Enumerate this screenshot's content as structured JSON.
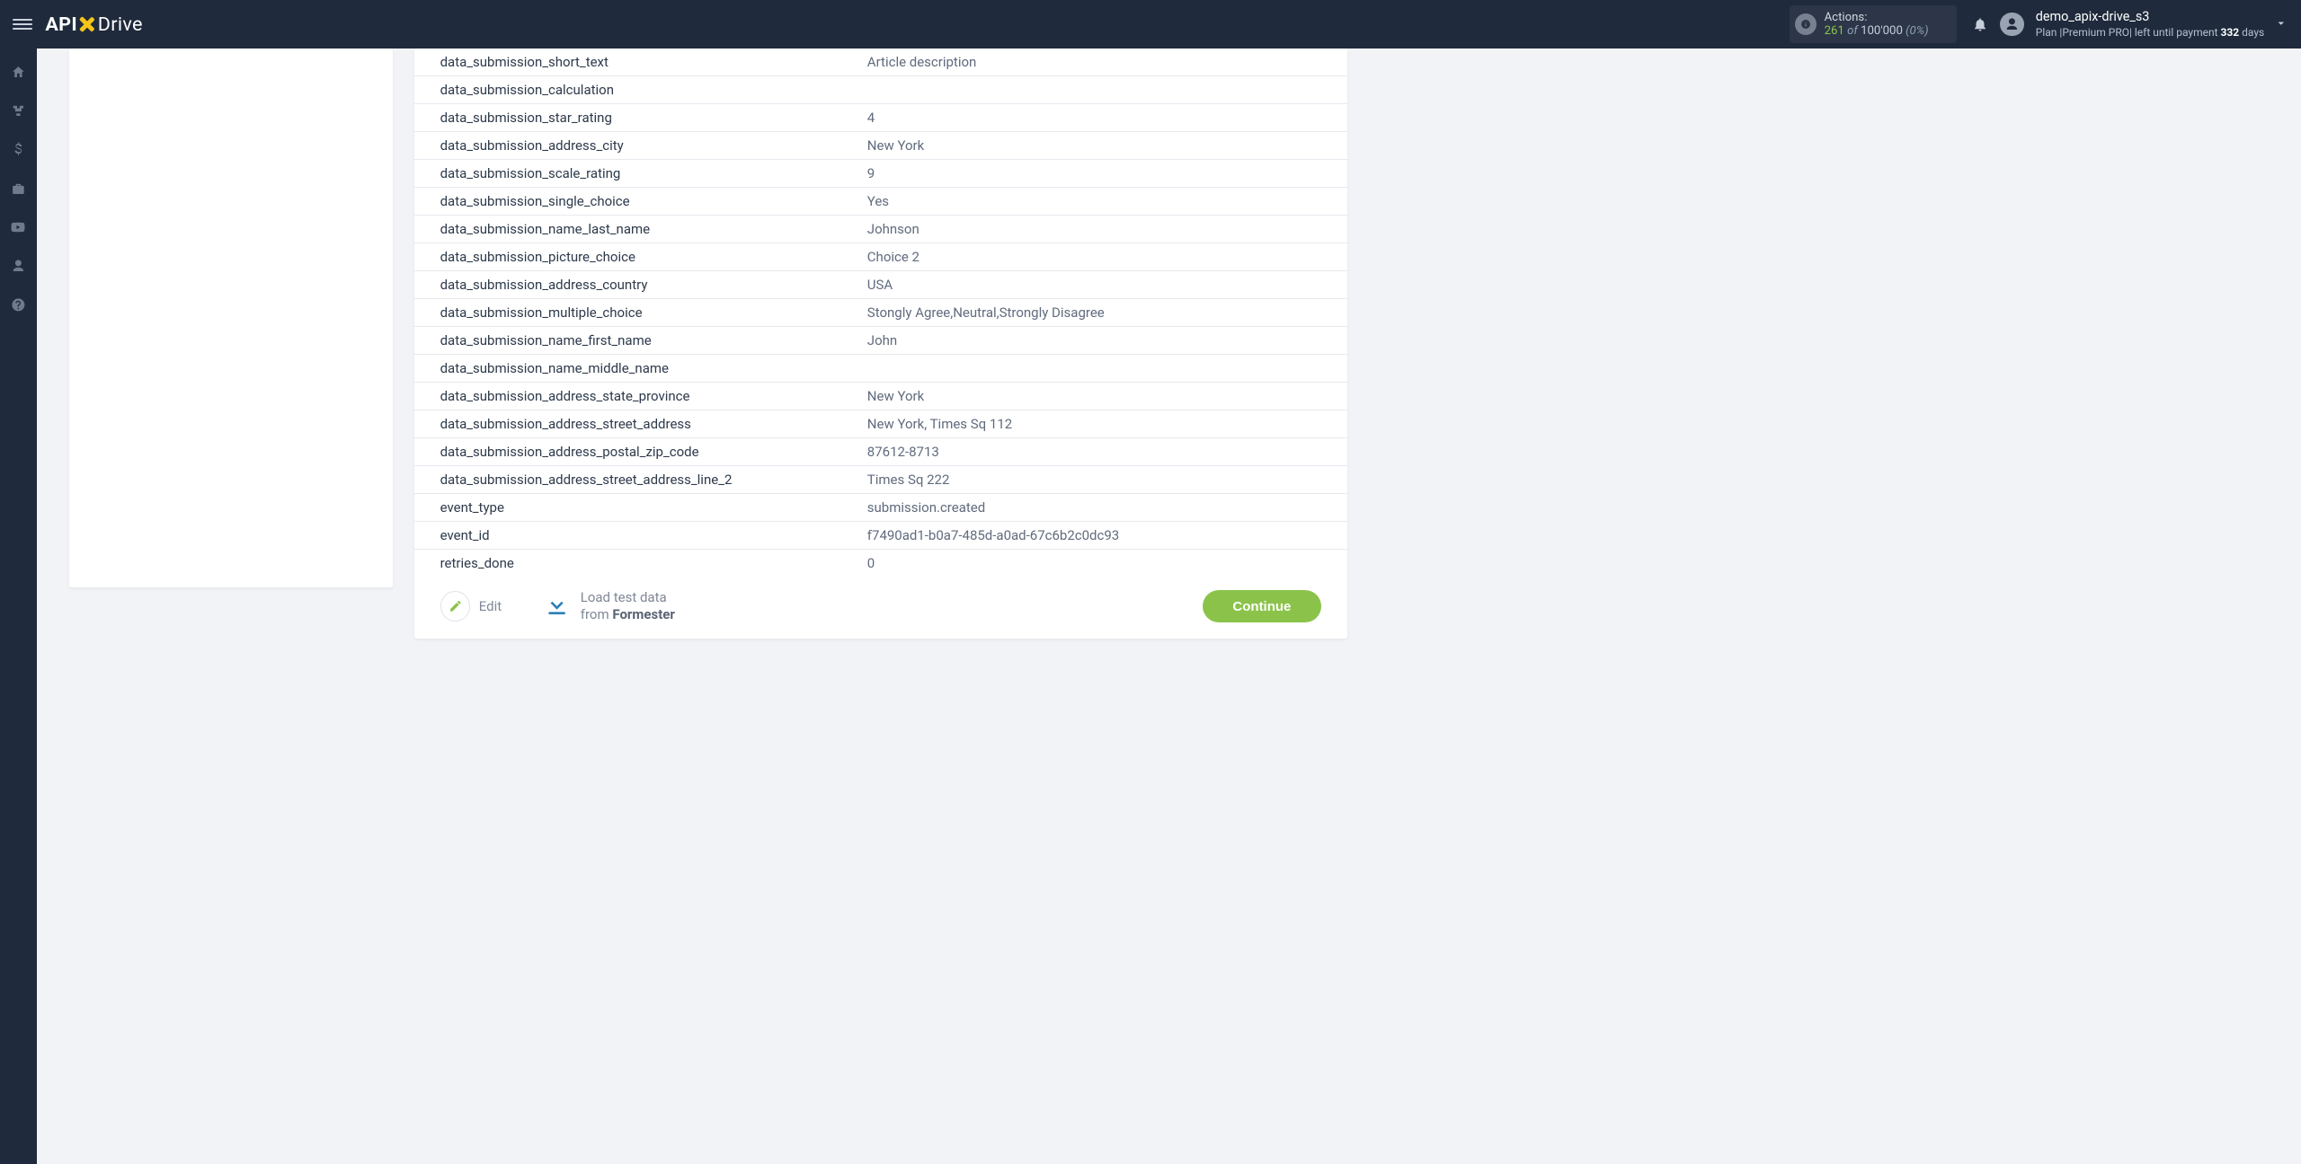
{
  "brand": {
    "api": "API",
    "drive": "Drive"
  },
  "actions": {
    "label": "Actions:",
    "count": "261",
    "of_word": "of",
    "total": "100'000",
    "pct": "(0%)"
  },
  "account": {
    "name": "demo_apix-drive_s3",
    "plan_prefix": "Plan |",
    "plan_name": "Premium PRO",
    "plan_mid": "| left until payment ",
    "days_num": "332",
    "days_suffix": " days"
  },
  "rows": [
    {
      "key": "data_submission_short_text",
      "val": "Article description"
    },
    {
      "key": "data_submission_calculation",
      "val": ""
    },
    {
      "key": "data_submission_star_rating",
      "val": "4"
    },
    {
      "key": "data_submission_address_city",
      "val": "New York"
    },
    {
      "key": "data_submission_scale_rating",
      "val": "9"
    },
    {
      "key": "data_submission_single_choice",
      "val": "Yes"
    },
    {
      "key": "data_submission_name_last_name",
      "val": "Johnson"
    },
    {
      "key": "data_submission_picture_choice",
      "val": "Choice 2"
    },
    {
      "key": "data_submission_address_country",
      "val": "USA"
    },
    {
      "key": "data_submission_multiple_choice",
      "val": "Stongly Agree,Neutral,Strongly Disagree"
    },
    {
      "key": "data_submission_name_first_name",
      "val": "John"
    },
    {
      "key": "data_submission_name_middle_name",
      "val": ""
    },
    {
      "key": "data_submission_address_state_province",
      "val": "New York"
    },
    {
      "key": "data_submission_address_street_address",
      "val": "New York, Times Sq 112"
    },
    {
      "key": "data_submission_address_postal_zip_code",
      "val": "87612-8713"
    },
    {
      "key": "data_submission_address_street_address_line_2",
      "val": "Times Sq 222"
    },
    {
      "key": "event_type",
      "val": "submission.created"
    },
    {
      "key": "event_id",
      "val": "f7490ad1-b0a7-485d-a0ad-67c6b2c0dc93"
    },
    {
      "key": "retries_done",
      "val": "0"
    }
  ],
  "edit_label": "Edit",
  "load": {
    "line1": "Load test data",
    "from": "from ",
    "source": "Formester"
  },
  "continue_label": "Continue"
}
